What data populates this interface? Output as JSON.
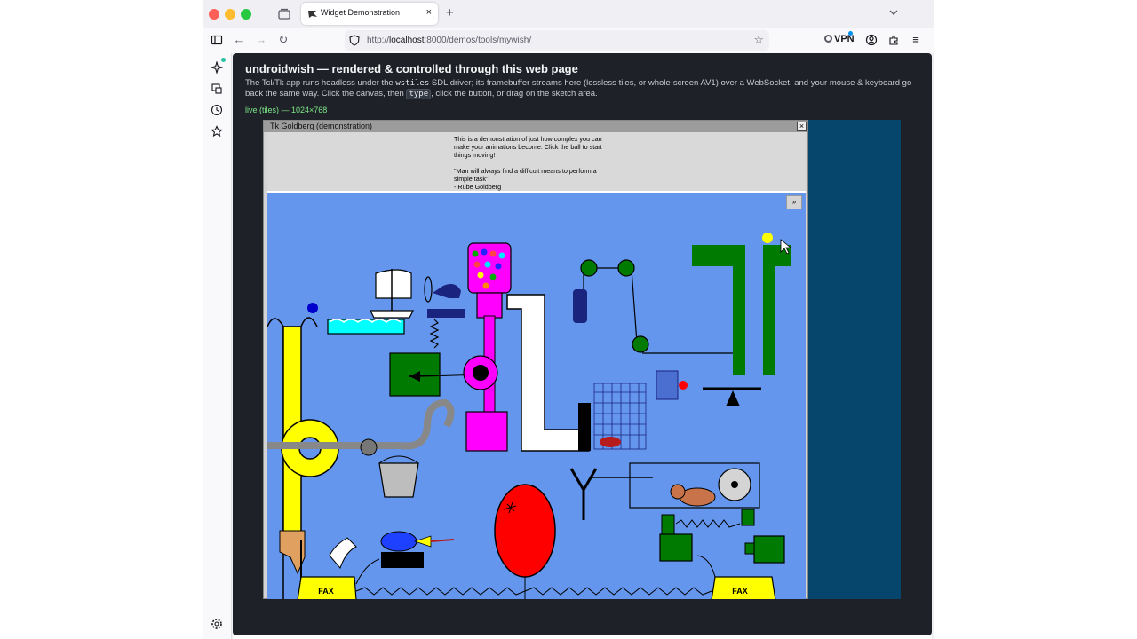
{
  "browser": {
    "tab_title": "Widget Demonstration",
    "url_prefix": "http://",
    "url_host": "localhost",
    "url_path": ":8000/demos/tools/mywish/",
    "vpn_label": "VPN",
    "icons": {
      "tab_close": "×",
      "new_tab": "+",
      "back": "←",
      "forward": "→",
      "reload": "↻",
      "bookmark": "☆",
      "menu": "≡"
    }
  },
  "page": {
    "title": "undroidwish — rendered & controlled through this web page",
    "desc_part1": "The Tcl/Tk app runs headless under the ",
    "desc_code1": "wstiles",
    "desc_part2": " SDL driver; its framebuffer streams here (lossless tiles, or whole-screen AV1) over a WebSocket, and your mouse & keyboard go back the same way. Click the canvas, then ",
    "desc_code2": "type",
    "desc_part3": ", click the button, or drag on the sketch area.",
    "status": "live (tiles) — 1024×768"
  },
  "tk": {
    "window_title": "Tk Goldberg (demonstration)",
    "close_glyph": "×",
    "message_lines": [
      "This is a demonstration of just how complex you can",
      "make your animations become. Click the ball to start",
      "things moving!",
      "",
      "\"Man will always find a difficult means to perform a",
      "simple task\"",
      " - Rube Goldberg"
    ],
    "step_button": "»",
    "fax_label": "FAX"
  },
  "colors": {
    "scene_bg": "#6496ed",
    "canvas_bg": "#06456c",
    "page_bg": "#1e2228",
    "status_green": "#7ee787"
  }
}
